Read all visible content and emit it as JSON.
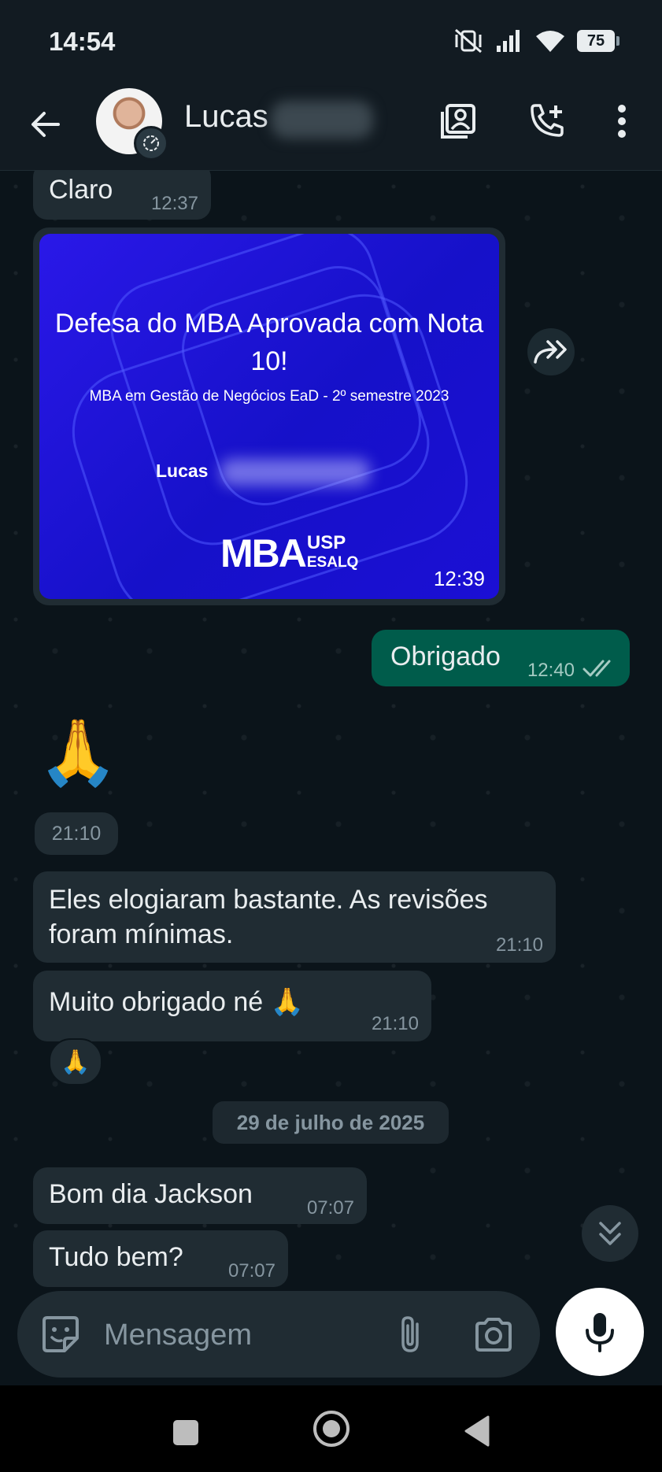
{
  "status_bar": {
    "time": "14:54",
    "battery": "75"
  },
  "header": {
    "contact_name": "Lucas"
  },
  "messages": [
    {
      "text": "Claro",
      "time": "12:37"
    },
    {
      "type": "image",
      "title": "Defesa do MBA Aprovada com Nota 10!",
      "subtitle": "MBA em Gestão de Negócios EaD - 2º semestre 2023",
      "name": "Lucas",
      "logo_main": "MBA",
      "logo_top": "USP",
      "logo_bottom": "ESALQ",
      "time": "12:39"
    },
    {
      "text": "Obrigado",
      "time": "12:40",
      "outgoing": true
    },
    {
      "emoji": "🙏",
      "time": "21:10"
    },
    {
      "text": "Eles elogiaram bastante. As revisões foram mínimas.",
      "time": "21:10"
    },
    {
      "text": "Muito obrigado né 🙏",
      "time": "21:10",
      "reaction": "🙏"
    },
    {
      "text": "Bom dia Jackson",
      "time": "07:07"
    },
    {
      "text": "Tudo bem?",
      "time": "07:07"
    }
  ],
  "date_separator": "29 de julho de 2025",
  "composer": {
    "placeholder": "Mensagem"
  }
}
